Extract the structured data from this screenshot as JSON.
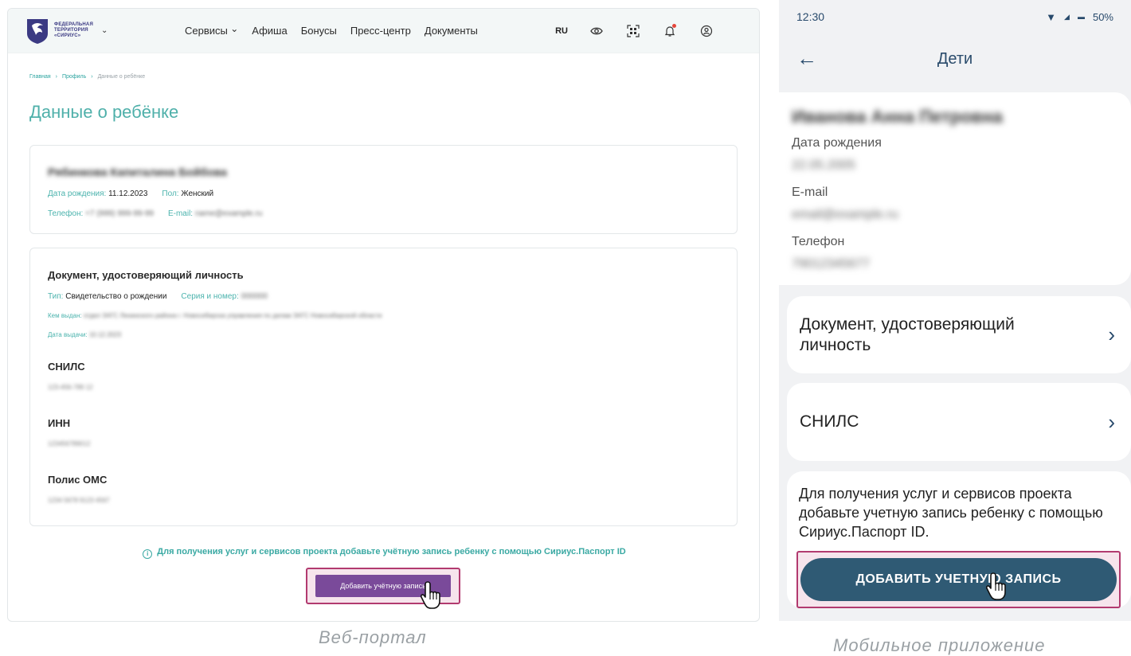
{
  "web": {
    "logo_lines": [
      "ФЕДЕРАЛЬНАЯ",
      "ТЕРРИТОРИЯ",
      "«СИРИУС»"
    ],
    "nav": [
      "Сервисы",
      "Афиша",
      "Бонусы",
      "Пресс-центр",
      "Документы"
    ],
    "lang": "RU",
    "icons": [
      "eye-icon",
      "qr-icon",
      "bell-icon",
      "user-icon"
    ],
    "breadcrumb": [
      "Главная",
      "Профиль",
      "Данные о ребёнке"
    ],
    "page_title": "Данные о ребёнке",
    "child": {
      "name": "Рябинкова Капиталина Бойбова",
      "birth_label": "Дата рождения:",
      "birth_value": "11.12.2023",
      "gender_label": "Пол:",
      "gender_value": "Женский",
      "phone_label": "Телефон:",
      "phone_value": "+7 (999) 999-99-99",
      "email_label": "E-mail:",
      "email_value": "name@example.ru"
    },
    "doc": {
      "title": "Документ, удостоверяющий личность",
      "type_label": "Тип:",
      "type_value": "Свидетельство о рождении",
      "series_label": "Серия и номер:",
      "series_value": "000000",
      "issued_label": "Кем выдан:",
      "issued_value": "отдел ЗАГС Ленинского района г. Новосибирска управления по делам ЗАГС Новосибирской области",
      "date_label": "Дата выдачи:",
      "date_value": "10.12.2023",
      "snils_title": "СНИЛС",
      "snils_value": "123-456-789 12",
      "inn_title": "ИНН",
      "inn_value": "123456789012",
      "oms_title": "Полис ОМС",
      "oms_value": "1234 5678 9123 4567"
    },
    "info": "Для получения услуг и сервисов проекта добавьте учётную запись ребенку с помощью Сириус.Паспорт ID",
    "add_button": "Добавить учётную запись",
    "caption": "Веб-портал"
  },
  "mobile": {
    "time": "12:30",
    "battery": "50%",
    "title": "Дети",
    "name": "Иванова Анна Петровна",
    "birth_label": "Дата рождения",
    "birth_value": "22.05.2005",
    "email_label": "E-mail",
    "email_value": "email@example.ru",
    "phone_label": "Телефон",
    "phone_value": "79012345677",
    "doc_item": "Документ, удостоверяющий личность",
    "snils_item": "СНИЛС",
    "info": "Для получения услуг и сервисов проекта добавьте учетную запись ребенку с помощью Сириус.Паспорт ID.",
    "add_button": "ДОБАВИТЬ УЧЕТНУЮ ЗАПИСЬ",
    "caption": "Мобильное приложение"
  },
  "colors": {
    "teal": "#4fb0aa",
    "purple_button": "#7a4a9a",
    "mobile_button": "#2f5a74",
    "highlight_border": "#b23a6f"
  }
}
